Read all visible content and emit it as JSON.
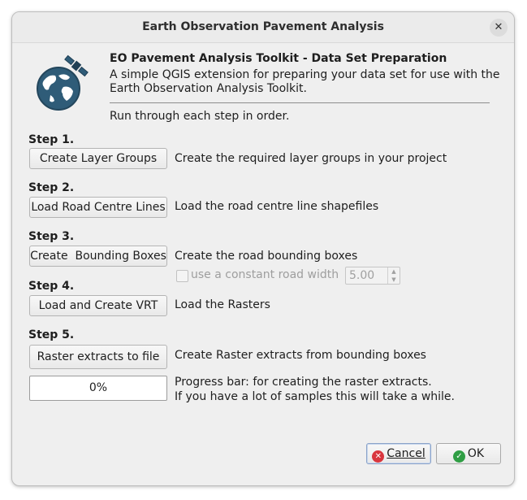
{
  "window": {
    "title": "Earth Observation Pavement Analysis",
    "close_icon": "close-icon"
  },
  "header": {
    "logo_icon": "globe-satellite-icon",
    "heading": "EO Pavement Analysis Toolkit - Data Set Preparation",
    "description_line1": "A simple QGIS extension for preparing your data set for use with the",
    "description_line2": "Earth Observation Analysis Toolkit.",
    "instruction": "Run through each step in order."
  },
  "steps": [
    {
      "label": "Step 1.",
      "button": "Create Layer Groups",
      "description": "Create the required layer groups in your project"
    },
    {
      "label": "Step 2.",
      "button": "Load Road Centre Lines",
      "description": "Load the road centre line shapefiles"
    },
    {
      "label": "Step 3.",
      "button": "Create  Bounding Boxes",
      "description": "Create the road bounding boxes"
    },
    {
      "label": "Step 4.",
      "button": "Load and Create VRT",
      "description": "Load the Rasters"
    },
    {
      "label": "Step 5.",
      "button": "Raster extracts to file",
      "description": "Create Raster extracts from bounding boxes"
    }
  ],
  "road_width": {
    "checkbox_label": "use a constant road width",
    "checked": false,
    "value": "5.00"
  },
  "progress": {
    "value_text": "0%",
    "percent": 0,
    "note_line1": "Progress bar: for creating the raster extracts.",
    "note_line2": "If you have a lot of samples this will take a while."
  },
  "buttons": {
    "cancel": "Cancel",
    "ok": "OK",
    "cancel_mnemonic": "C",
    "ok_mnemonic": "O"
  }
}
